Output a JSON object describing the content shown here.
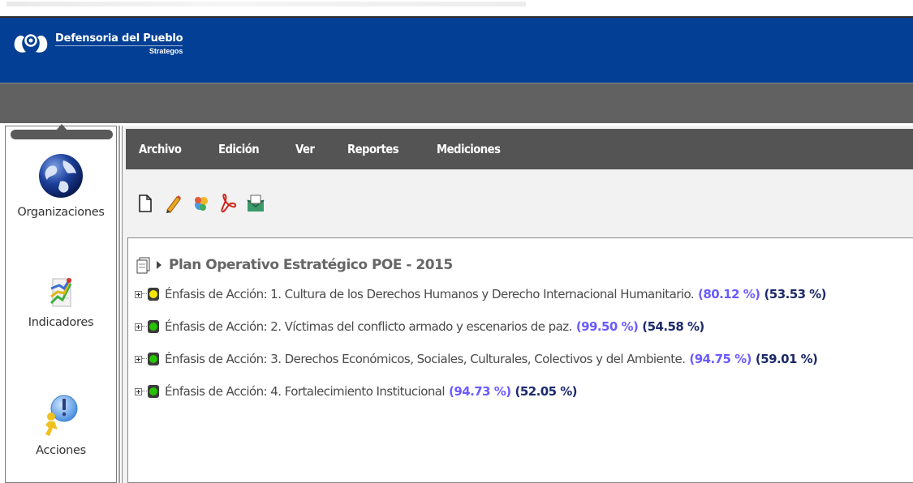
{
  "header": {
    "org_name": "Defensoria del Pueblo",
    "app_name": "Strategos",
    "brand_color": "#033f94"
  },
  "sidebar": {
    "items": [
      {
        "label": "Organizaciones",
        "icon": "globe-icon"
      },
      {
        "label": "Indicadores",
        "icon": "indicators-chart-icon"
      },
      {
        "label": "Acciones",
        "icon": "actions-person-icon"
      }
    ]
  },
  "menu": {
    "items": [
      "Archivo",
      "Edición",
      "Ver",
      "Reportes",
      "Mediciones"
    ]
  },
  "toolbar": {
    "icons": [
      "new-document-icon",
      "edit-pencil-icon",
      "properties-icon",
      "pdf-icon",
      "mail-icon"
    ]
  },
  "tree": {
    "plan_title": "Plan Operativo Estratégico POE - 2015",
    "rows": [
      {
        "text": "Énfasis de Acción: 1. Cultura de los Derechos Humanos y Derecho Internacional Humanitario.",
        "pct1": "(80.12 %)",
        "pct2": "(53.53 %)",
        "status": "yellow"
      },
      {
        "text": "Énfasis de Acción: 2. Víctimas del conflicto armado y escenarios de paz.",
        "pct1": "(99.50 %)",
        "pct2": "(54.58 %)",
        "status": "green"
      },
      {
        "text": "Énfasis de Acción: 3. Derechos Económicos, Sociales, Culturales, Colectivos y del Ambiente.",
        "pct1": "(94.75 %)",
        "pct2": "(59.01 %)",
        "status": "green"
      },
      {
        "text": "Énfasis de Acción: 4. Fortalecimiento Institucional",
        "pct1": "(94.73 %)",
        "pct2": "(52.05 %)",
        "status": "green"
      }
    ]
  }
}
